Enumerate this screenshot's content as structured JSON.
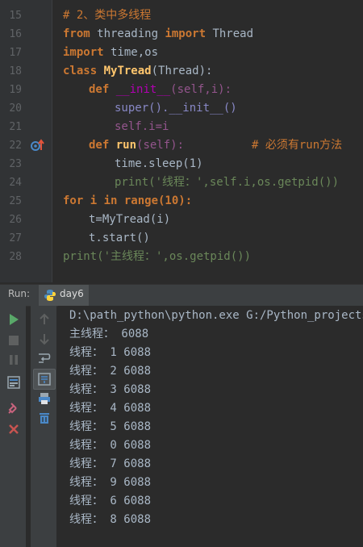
{
  "editor": {
    "lines": [
      {
        "num": "15",
        "comment": "# 2、类中多线程"
      },
      {
        "num": "16",
        "kw1": "from",
        "mod": " threading ",
        "kw2": "import",
        "cls": " Thread"
      },
      {
        "num": "17",
        "kw1": "import",
        "rest": " time,os"
      },
      {
        "num": "18",
        "kw1": "class",
        "name": " MyTread",
        "paren": "(Thread):"
      },
      {
        "num": "19",
        "kw1": "def",
        "fn": " __init__",
        "rest": "(self,i):"
      },
      {
        "num": "20",
        "rest": "super().__init__()"
      },
      {
        "num": "21",
        "rest": "self.i=i"
      },
      {
        "num": "22",
        "kw1": "def",
        "fn": " run",
        "rest": "(self):",
        "comment": "# 必须有run方法"
      },
      {
        "num": "23",
        "rest": "time.sleep(1)"
      },
      {
        "num": "24",
        "rest": "print('线程：',self.i,os.getpid())"
      },
      {
        "num": "25",
        "rest": "for i in range(10):"
      },
      {
        "num": "26",
        "rest": "t=MyTread(i)"
      },
      {
        "num": "27",
        "rest": "t.start()"
      },
      {
        "num": "28",
        "rest": "print('主线程：',os.getpid())"
      }
    ]
  },
  "run_panel": {
    "label": "Run:",
    "tab": "day6",
    "output": [
      "D:\\path_python\\python.exe G:/Python_projects/p",
      "主线程： 6088",
      "线程： 1 6088",
      "线程： 2 6088",
      "线程： 3 6088",
      "线程： 4 6088",
      "线程： 5 6088",
      "线程： 0 6088",
      "线程： 7 6088",
      "线程： 9 6088",
      "线程： 6 6088",
      "线程： 8 6088"
    ]
  }
}
